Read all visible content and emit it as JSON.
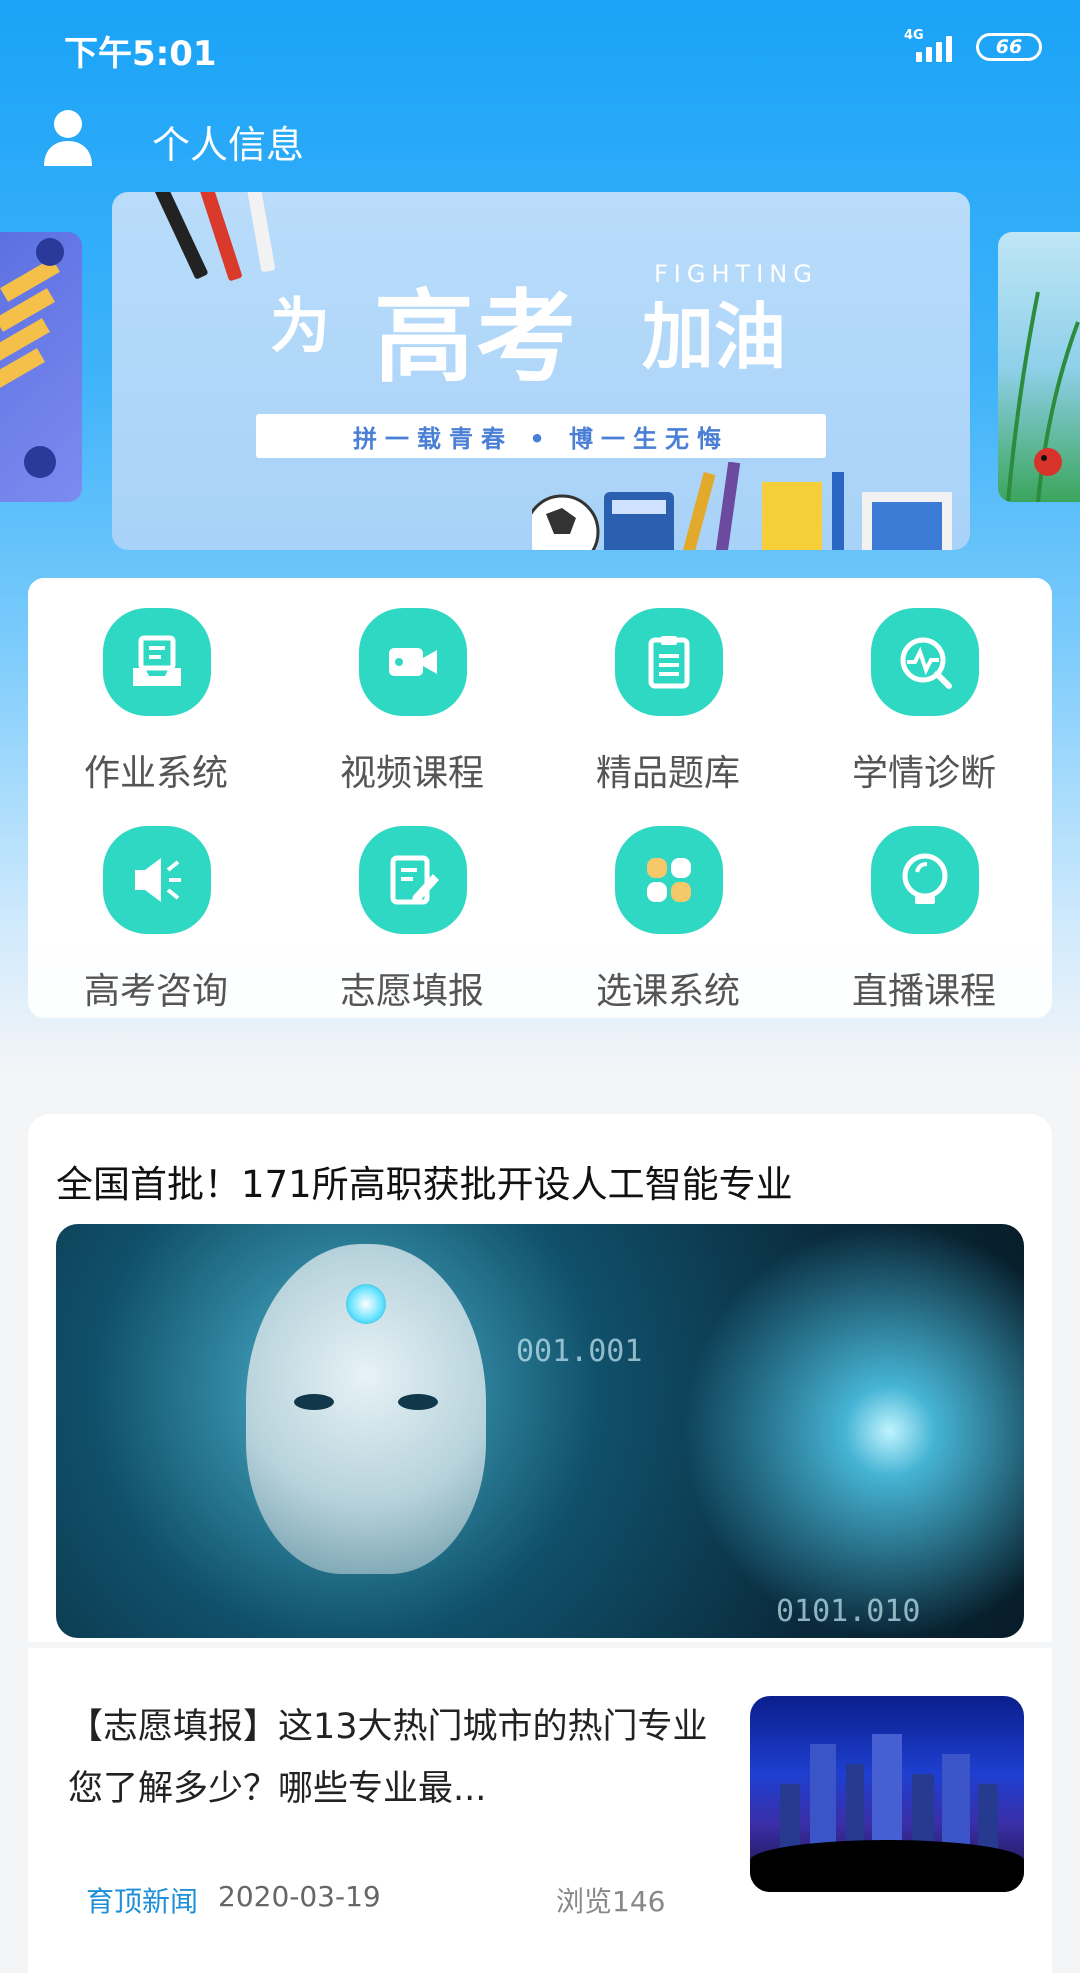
{
  "status_bar": {
    "time": "下午5:01",
    "network": "4G",
    "battery": "66"
  },
  "header": {
    "title": "个人信息",
    "avatar_icon": "person-icon"
  },
  "banner": {
    "small": "为",
    "big": "高考",
    "mid": "加油",
    "fighting": "FIGHTING",
    "ribbon": "拼一载青春 • 博一生无悔"
  },
  "features": [
    {
      "label": "作业系统",
      "icon": "inbox-document-icon"
    },
    {
      "label": "视频课程",
      "icon": "video-camera-icon"
    },
    {
      "label": "精品题库",
      "icon": "clipboard-list-icon"
    },
    {
      "label": "学情诊断",
      "icon": "diagnosis-search-icon"
    },
    {
      "label": "高考咨询",
      "icon": "megaphone-icon"
    },
    {
      "label": "志愿填报",
      "icon": "edit-document-icon"
    },
    {
      "label": "选课系统",
      "icon": "grid-apps-icon"
    },
    {
      "label": "直播课程",
      "icon": "lightbulb-icon"
    }
  ],
  "news": {
    "headline": "全国首批！171所高职获批开设人工智能专业",
    "hero_overlay_1": "001.001",
    "hero_overlay_2": "0101.010",
    "item": {
      "title": "【志愿填报】这13大热门城市的热门专业您了解多少？哪些专业最...",
      "source": "育顶新闻",
      "date": "2020-03-19",
      "views": "浏览146"
    }
  },
  "colors": {
    "header_blue": "#1aa3f7",
    "feature_teal": "#2ed8c3",
    "source_blue": "#1e8fd6"
  }
}
